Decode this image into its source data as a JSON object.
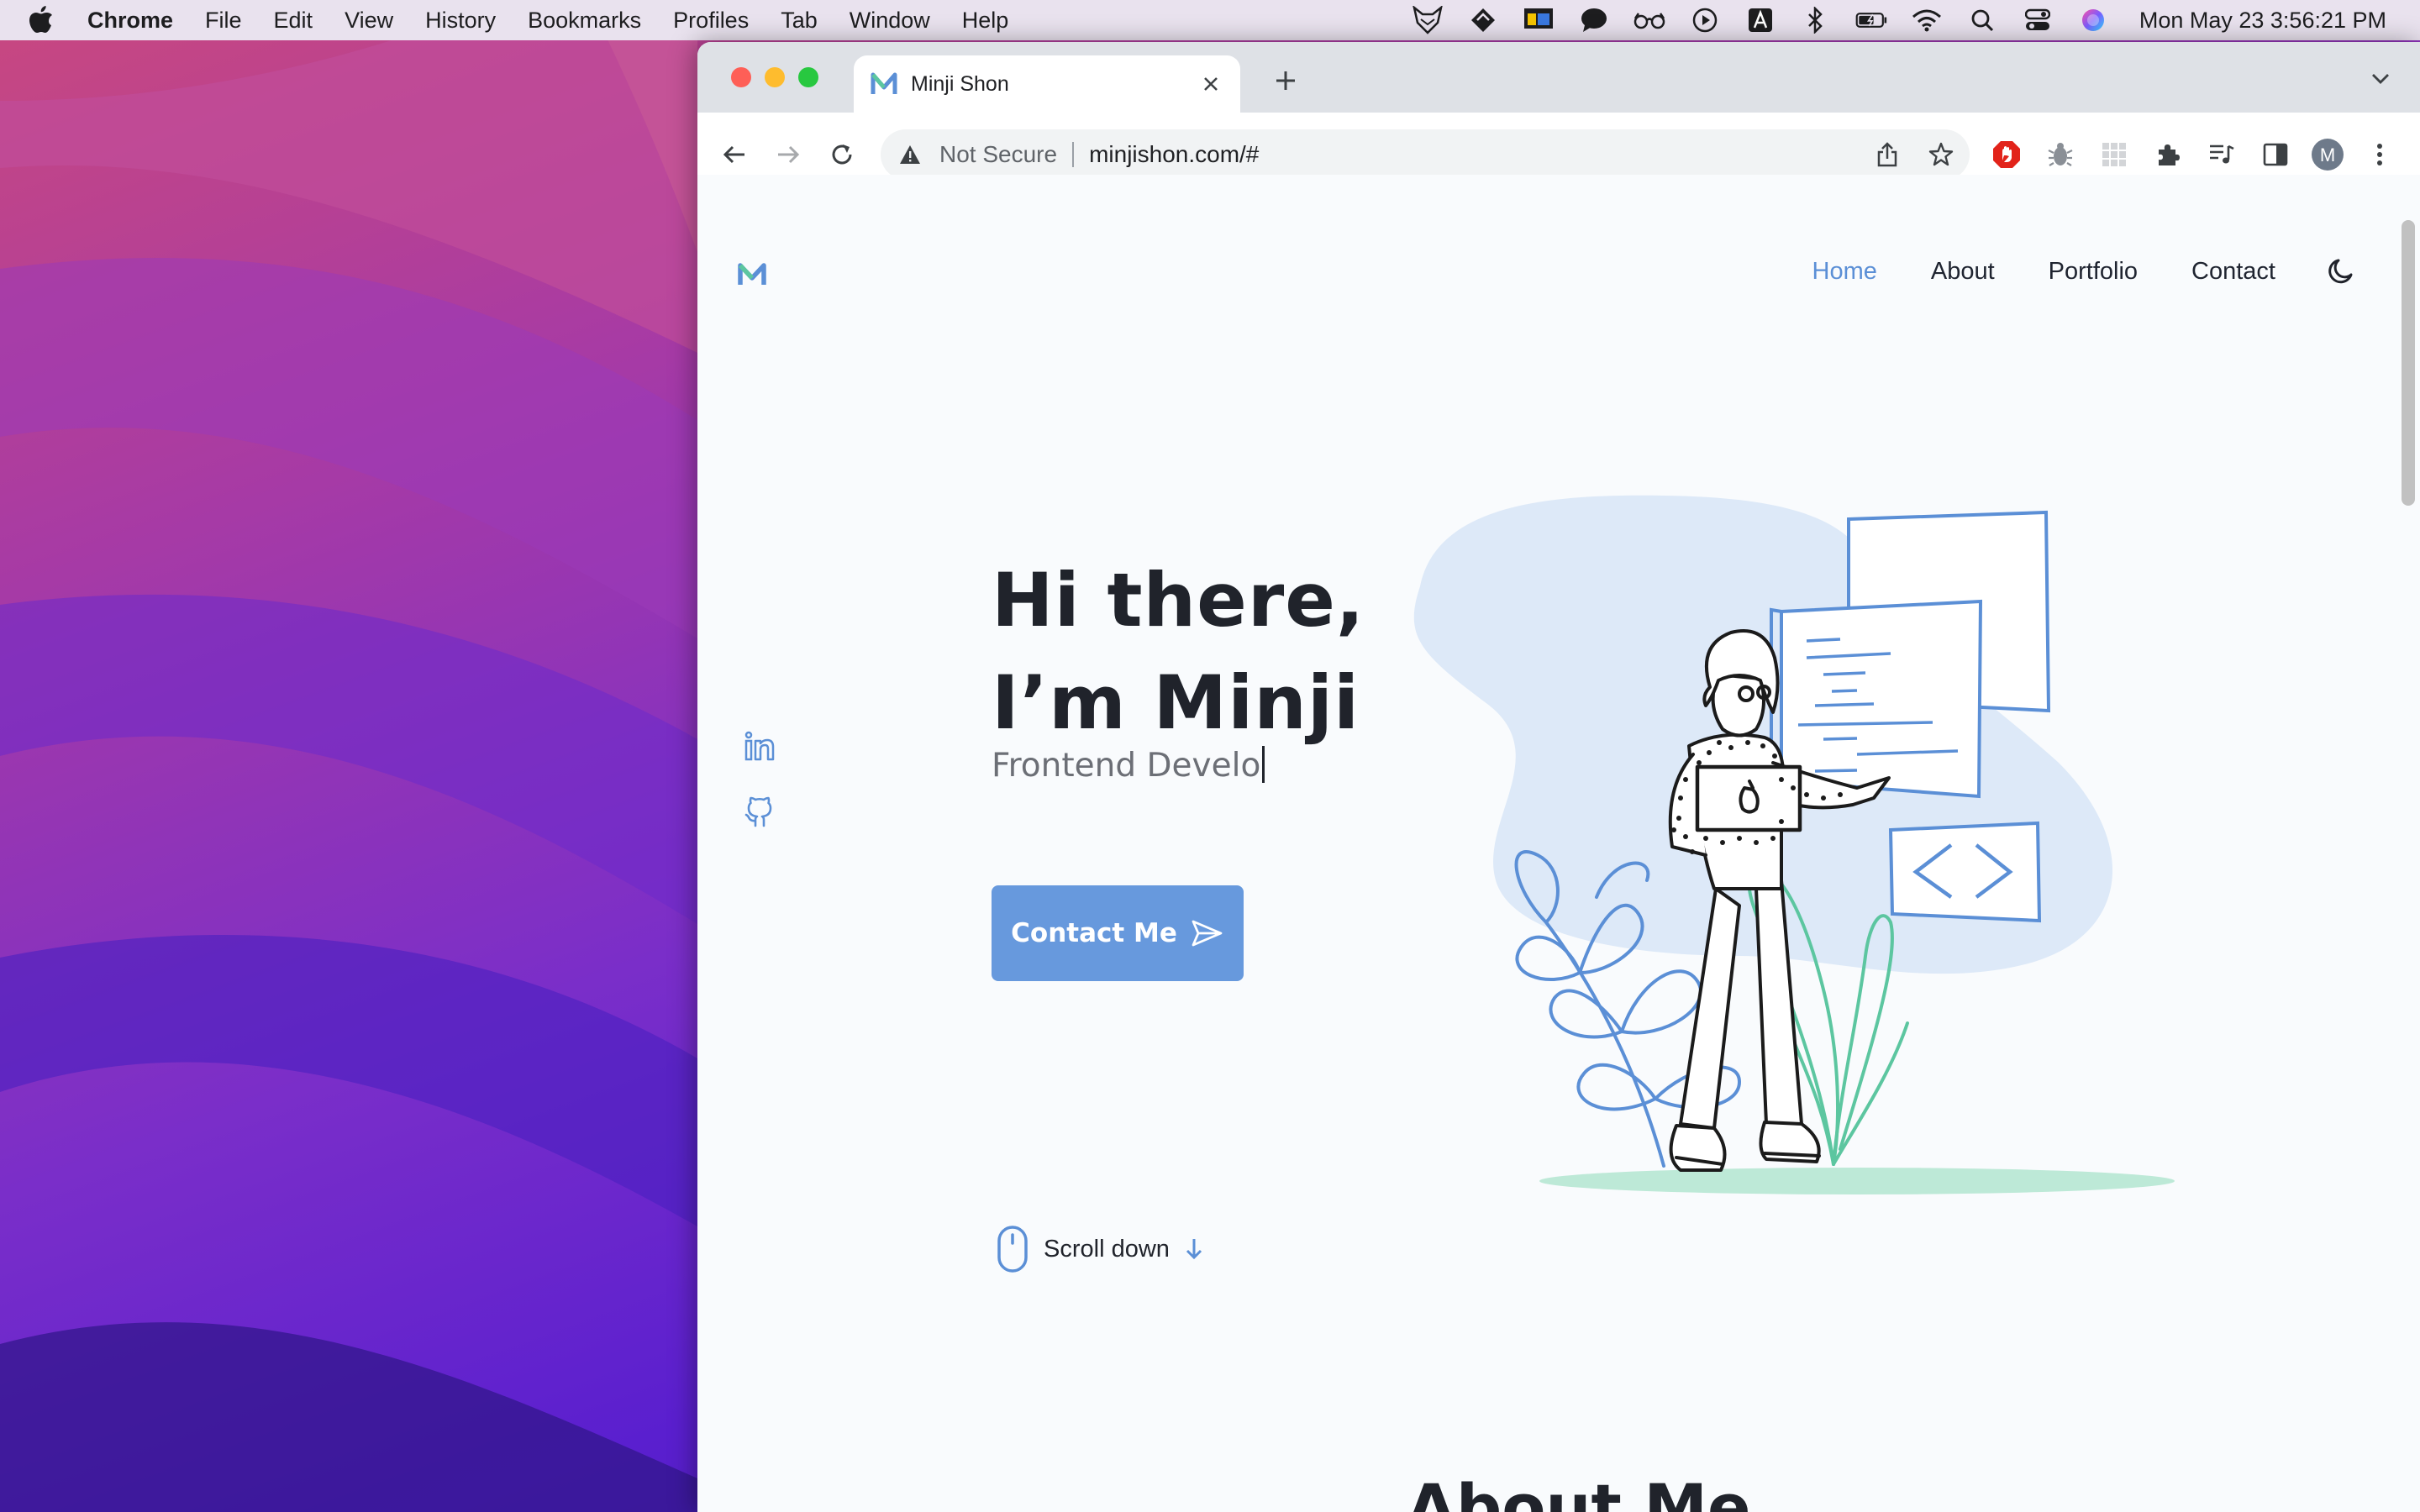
{
  "menubar": {
    "app": "Chrome",
    "items": [
      "File",
      "Edit",
      "View",
      "History",
      "Bookmarks",
      "Profiles",
      "Tab",
      "Window",
      "Help"
    ],
    "clock": "Mon May 23  3:56:21 PM"
  },
  "browser": {
    "tab_title": "Minji Shon",
    "security_label": "Not Secure",
    "url": "minjishon.com/#",
    "profile_initial": "M"
  },
  "site": {
    "nav": [
      "Home",
      "About",
      "Portfolio",
      "Contact"
    ],
    "active_nav": "Home",
    "hero_line1": "Hi there,",
    "hero_line2": "I’m Minji",
    "hero_subtitle": "Frontend Develo",
    "contact_button": "Contact Me",
    "scroll_label": "Scroll down",
    "about_title": "About Me"
  },
  "colors": {
    "accent": "#5b8fd6",
    "button": "#6799dd",
    "illustration_blob": "#dde9f8",
    "plant_green": "#5cc6a0"
  }
}
